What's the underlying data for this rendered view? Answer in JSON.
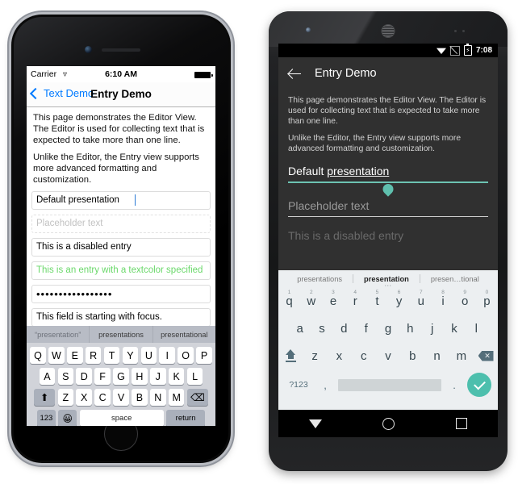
{
  "ios": {
    "status": {
      "carrier": "Carrier",
      "wifi_icon": "wifi-icon",
      "time": "6:10 AM",
      "battery_icon": "battery-full-icon"
    },
    "nav": {
      "back_label": "Text Demo",
      "back_icon": "chevron-left-icon",
      "title": "Entry Demo"
    },
    "paragraphs": [
      "This page demonstrates the Editor View. The Editor is used for collecting text that is expected to take more than one line.",
      "Unlike the Editor, the Entry view supports more advanced formatting and customization."
    ],
    "fields": [
      {
        "name": "default-presentation",
        "value": "Default presentation",
        "placeholder": "",
        "state": "focused"
      },
      {
        "name": "placeholder-entry",
        "value": "",
        "placeholder": "Placeholder text",
        "state": "empty"
      },
      {
        "name": "disabled-entry",
        "value": "This is a disabled entry",
        "placeholder": "",
        "state": "disabled"
      },
      {
        "name": "textcolor-entry",
        "value": "This is an entry with a textcolor specified",
        "placeholder": "",
        "state": "colored"
      },
      {
        "name": "password-entry",
        "value": "•••••••••••••••••",
        "placeholder": "",
        "state": "password"
      },
      {
        "name": "focus-entry",
        "value": "This field is starting with focus.",
        "placeholder": "",
        "state": "normal"
      }
    ],
    "keyboard": {
      "suggestions": [
        "“presentation”",
        "presentations",
        "presentational"
      ],
      "row1": [
        "Q",
        "W",
        "E",
        "R",
        "T",
        "Y",
        "U",
        "I",
        "O",
        "P"
      ],
      "row2": [
        "A",
        "S",
        "D",
        "F",
        "G",
        "H",
        "J",
        "K",
        "L"
      ],
      "row3": [
        "Z",
        "X",
        "C",
        "V",
        "B",
        "N",
        "M"
      ],
      "shift_icon": "shift-icon",
      "delete_icon": "backspace-icon",
      "numeric_label": "123",
      "emoji_icon": "emoji-icon",
      "space_label": "space",
      "return_label": "return"
    }
  },
  "android": {
    "status": {
      "wifi_icon": "wifi-icon",
      "signal_icon": "no-signal-icon",
      "battery_icon": "battery-charging-icon",
      "time": "7:08"
    },
    "appbar": {
      "back_icon": "arrow-left-icon",
      "title": "Entry Demo"
    },
    "paragraphs": [
      "This page demonstrates the Editor View. The Editor is used for collecting text that is expected to take more than one line.",
      "Unlike the Editor, the Entry view supports more advanced formatting and customization."
    ],
    "fields": [
      {
        "name": "default-presentation",
        "text_plain": "Default ",
        "text_marked": "presentation",
        "state": "focused-selected"
      },
      {
        "name": "placeholder-entry",
        "placeholder": "Placeholder text",
        "state": "empty"
      },
      {
        "name": "disabled-entry",
        "value": "This is a disabled entry",
        "state": "disabled"
      }
    ],
    "keyboard": {
      "suggestions": [
        "presentations",
        "presentation",
        "presen…tional"
      ],
      "selected_suggestion_index": 1,
      "more_icon": "more-dots-icon",
      "row1": [
        "q",
        "w",
        "e",
        "r",
        "t",
        "y",
        "u",
        "i",
        "o",
        "p"
      ],
      "row1_nums": [
        "1",
        "2",
        "3",
        "4",
        "5",
        "6",
        "7",
        "8",
        "9",
        "0"
      ],
      "row2": [
        "a",
        "s",
        "d",
        "f",
        "g",
        "h",
        "j",
        "k",
        "l"
      ],
      "row3": [
        "z",
        "x",
        "c",
        "v",
        "b",
        "n",
        "m"
      ],
      "shift_icon": "shift-caps-icon",
      "delete_icon": "backspace-icon",
      "symbols_label": "?123",
      "comma_label": ",",
      "period_label": ".",
      "enter_icon": "check-icon"
    },
    "navbar": {
      "back_icon": "nav-back-triangle-icon",
      "home_icon": "nav-home-circle-icon",
      "recents_icon": "nav-recents-square-icon"
    }
  },
  "colors": {
    "ios_accent": "#007aff",
    "ios_green_text": "#6ad86a",
    "android_accent": "#5fc0ae",
    "android_bg": "#303030",
    "android_keyboard_bg": "#eceff1"
  }
}
